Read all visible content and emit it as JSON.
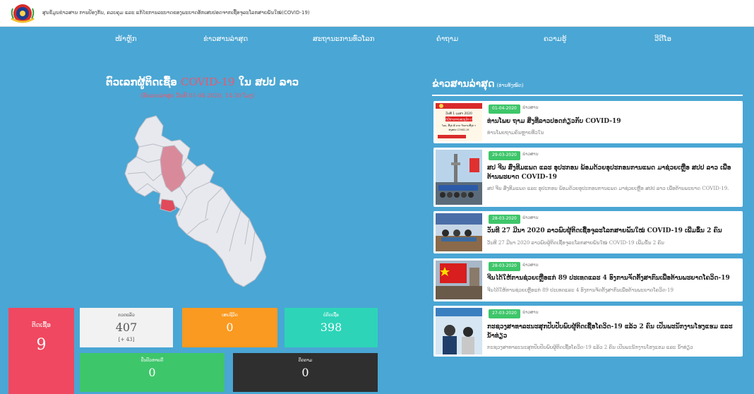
{
  "header": {
    "site_title": "ສູນຂໍ້ມູນຂ່າວສານ ການປ້ອງກັນ, ຄວບຄຸມ ແລະ ແກ້ໄຂການລະບາດຂອງພະຍາດອັກເສບປອດຈາກເຊື້ອຈຸລະໂລກສາຍພັນໃໝ່(COVID-19)"
  },
  "nav": [
    "ໜ້າຫຼັກ",
    "ຂ່າວສານລ່າສຸດ",
    "ສະຖານະການທົ່ວໂລກ",
    "ຄຳຖາມ",
    "ຄວາມຮູ້",
    "ວີດີໂອ"
  ],
  "stats": {
    "title_prefix": "ຕົວເລກຜູ້ຕິດເຊື້ອ ",
    "title_covid": "COVID-19",
    "title_suffix": " ໃນ ສປປ ລາວ",
    "updated": "(ອັບເດດລ່າສຸດ ວັນທີ 01-04-2020, 14:30 ໂມງ)"
  },
  "cards": {
    "infected": {
      "label": "ຕິດເຊື້ອ",
      "value": "9"
    },
    "tested": {
      "label": "ກວດແລ້ວ",
      "value": "407",
      "delta": "[+ 43]"
    },
    "deaths": {
      "label": "ເສຍຊີວິດ",
      "value": "0"
    },
    "negative": {
      "label": "ບໍ່ຕິດເຊື້ອ",
      "value": "398"
    },
    "recovered": {
      "label": "ປິ່ນປົວຫາຍດີ",
      "value": "0"
    },
    "monitoring": {
      "label": "ຕິດຕາມ",
      "value": "0"
    }
  },
  "news": {
    "title": "ຂ່າວສານລ່າສຸດ",
    "subtitle": "(ອ່ານທັງໝົດ)",
    "items": [
      {
        "date": "01-04-2020",
        "category": "ຂ່າວສານ",
        "headline": "ທ່ານໂພຍ ຖາມ ສິ່ງທີ່ລາວປອດກ່ຽວກັບ COVID-19",
        "excerpt": "ທ່ານໂພຍຖາມຄົນຫຼາຍທີ່ວໃນ"
      },
      {
        "date": "29-03-2020",
        "category": "ຂ່າວສານ",
        "headline": "ສປ ຈີນ ສົ່ງທີມແພດ ແລະ ອຸປະກອນ ພ້ອມດ້ວຍອຸປະກອນການແພດ ມາຊ່ວຍເຫຼືອ ສປປ ລາວ ເພື່ອຕ້ານພະຍາດ COVID-19",
        "excerpt": "ສປ ຈີນ ສົ່ງທີມແພດ ແລະ ອຸປະກອນ ພ້ອມດ້ວຍອຸປະກອນການແພດ ມາຊ່ວຍເຫຼືອ ສປປ ລາວ ເພື່ອຕ້ານພະຍາດ COVID-19."
      },
      {
        "date": "28-03-2020",
        "category": "ຂ່າວສານ",
        "headline": "ວັນທີ 27 ມີນາ 2020 ລາວພົບຜູ້ຕິດເຊື້ອຈຸລະໂລກສາຍພັນໃໝ່ COVID-19 ເພີ່ມຂຶ້ນ 2 ຄົນ",
        "excerpt": "ວັນທີ 27 ມີນາ 2020 ລາວພົບຜູ້ຕິດເຊື້ອຈຸລະໂລກສາຍພັນໃໝ່ COVID-19 ເພີ່ມຂຶ້ນ 2 ຄົນ"
      },
      {
        "date": "28-03-2020",
        "category": "ຂ່າວສານ",
        "headline": "ຈີນໄດ້ໃຫ້ການຊ່ວຍເຫຼືອແກ່ 89 ປະເທດແລະ 4 ອົງການຈັດຕັ້ງສາກົນເພື່ອຕ້ານພະຍາດໂຄວິດ-19",
        "excerpt": "ຈີນໄດ້ໃຫ້ການຊ່ວຍເຫຼືອແກ່ 89 ປະເທດແລະ 4 ອົງການຈັດຕັ້ງສາກົນເພື່ອຕ້ານພະຍາດໂຄວິດ-19"
      },
      {
        "date": "27-03-2020",
        "category": "ຂ່າວສານ",
        "headline": "ກະຊວງສາທາລະນະສຸກປັບປັບພົບຜູ້ຕິດເຊື້ອໂຄວິດ-19 ແລ້ວ 2 ຄົນ ເປັນພະນັກງານໂຮງແຮມ ແລະ ນ້ຳທ່ຽວ",
        "excerpt": "ກະຊວງສາທາລະນະສຸກປັບປັບພົບຜູ້ຕິດເຊື້ອໂຄວິດ-19 ແລ້ວ 2 ຄົນ ເປັນພະນັກງານໂຮງແຮມ ແລະ ນ້ຳທ່ຽວ"
      }
    ]
  },
  "thumb_caption": {
    "line1": "ວັນທີ 1 ເມສາ 2020",
    "banner": "ບໍ່ມີຂ່າວການອະນຸມັດ ປ",
    "line2": "ໂລດ, ສີ່ງຕ່ ຜົ ດາຍ ຈົບດາຍສີ່ງຕ່ າ",
    "line3": "ສ່ງສປະ COVID-19"
  },
  "colors": {
    "background": "#4aa6d4",
    "infected": "#f04860",
    "tested": "#f2f2f2",
    "deaths": "#fa9a20",
    "negative": "#2dd4b8",
    "recovered": "#3ec66a",
    "monitoring": "#2f2f2f",
    "date_badge": "#3ec66a"
  }
}
